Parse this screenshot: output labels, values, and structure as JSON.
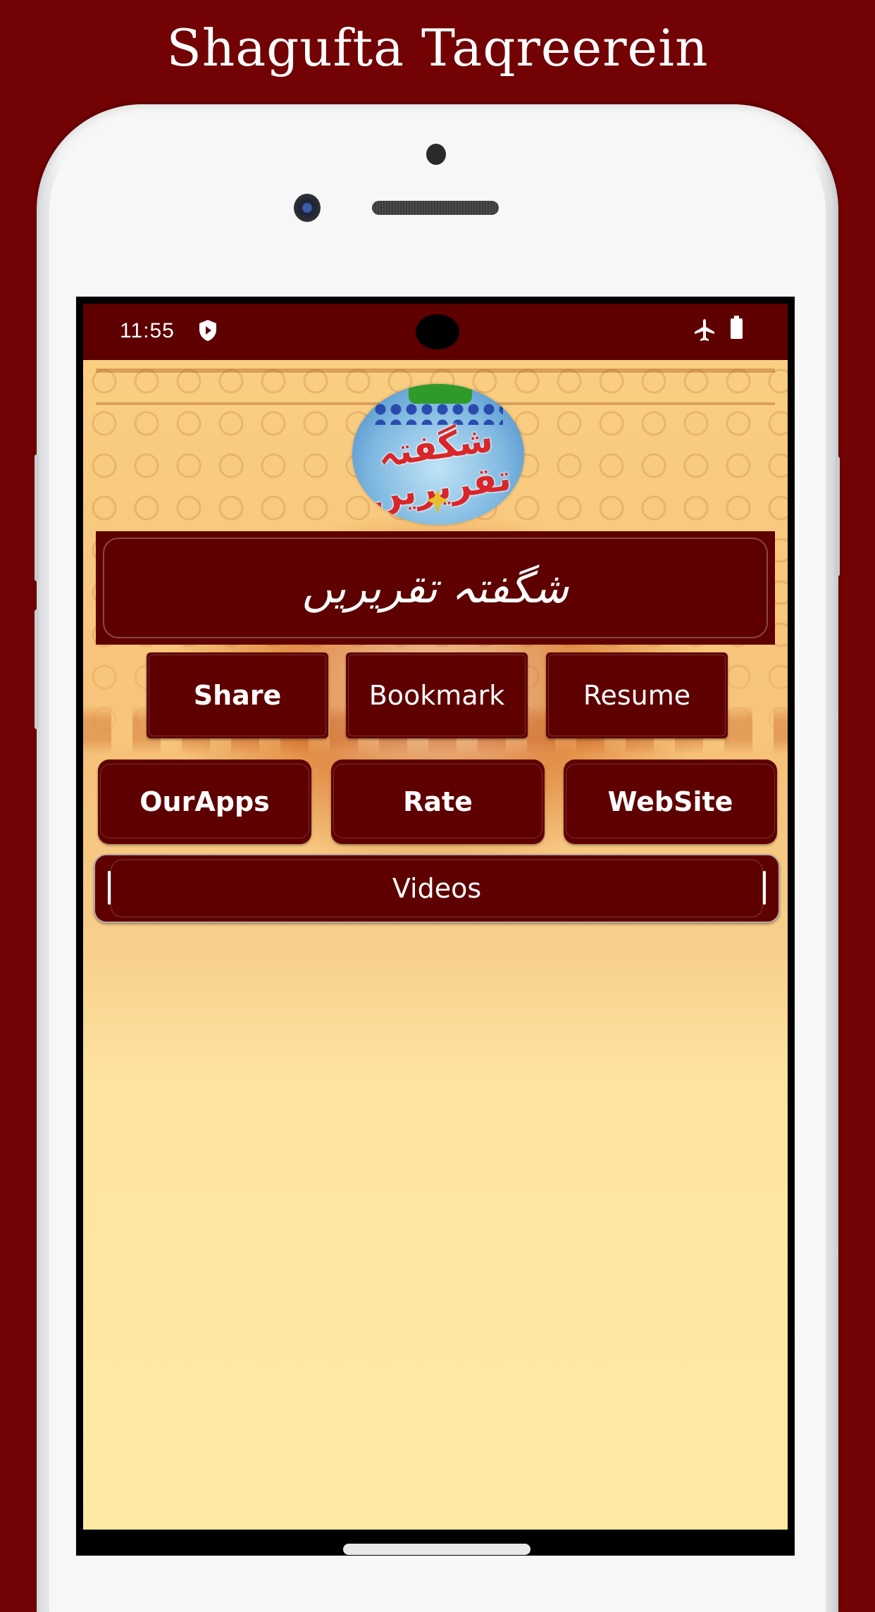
{
  "promo": {
    "title": "Shagufta Taqreerein"
  },
  "status_bar": {
    "time": "11:55",
    "icons": [
      "shield-play-icon",
      "airplane-mode-icon",
      "battery-full-icon"
    ]
  },
  "app": {
    "logo_text": "شگفتہ تقریریں",
    "title_urdu": "شگفتہ تقریریں",
    "buttons_row1": [
      {
        "label": "Share"
      },
      {
        "label": "Bookmark"
      },
      {
        "label": "Resume"
      }
    ],
    "buttons_row2": [
      {
        "label": "OurApps"
      },
      {
        "label": "Rate"
      },
      {
        "label": "WebSite"
      }
    ],
    "videos_button": {
      "label": "Videos"
    }
  },
  "colors": {
    "page_background": "#720204",
    "button_fill": "#5e0000",
    "status_bar": "#5e0000",
    "app_background": "#ffeaa3"
  }
}
